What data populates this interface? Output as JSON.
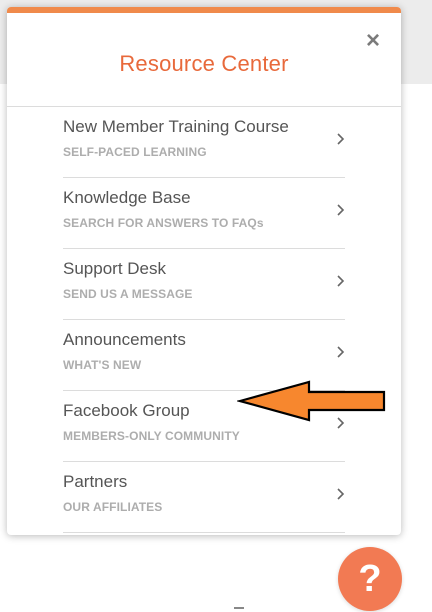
{
  "resource_center": {
    "title": "Resource Center",
    "close_symbol": "×",
    "items": [
      {
        "label": "New Member Training Course",
        "subtitle": "SELF-PACED LEARNING",
        "icon": "chevron-right-icon"
      },
      {
        "label": "Knowledge Base",
        "subtitle": "SEARCH FOR ANSWERS TO FAQs",
        "icon": "chevron-right-icon"
      },
      {
        "label": "Support Desk",
        "subtitle": "SEND US A MESSAGE",
        "icon": "chevron-right-icon"
      },
      {
        "label": "Announcements",
        "subtitle": "WHAT'S NEW",
        "icon": "chevron-right-icon"
      },
      {
        "label": "Facebook Group",
        "subtitle": "MEMBERS-ONLY COMMUNITY",
        "icon": "chevron-right-icon"
      },
      {
        "label": "Partners",
        "subtitle": "OUR AFFILIATES",
        "icon": "chevron-right-icon"
      }
    ]
  },
  "help_button": {
    "symbol": "?"
  },
  "annotation": {
    "type": "arrow-pointer",
    "points_to": "Facebook Group"
  },
  "colors": {
    "accent": "#e8693b",
    "top_bar": "#f08a4b",
    "help_button": "#f27a53",
    "arrow_fill": "#f7872e",
    "label_text": "#555555",
    "subtitle_text": "#adadad"
  }
}
